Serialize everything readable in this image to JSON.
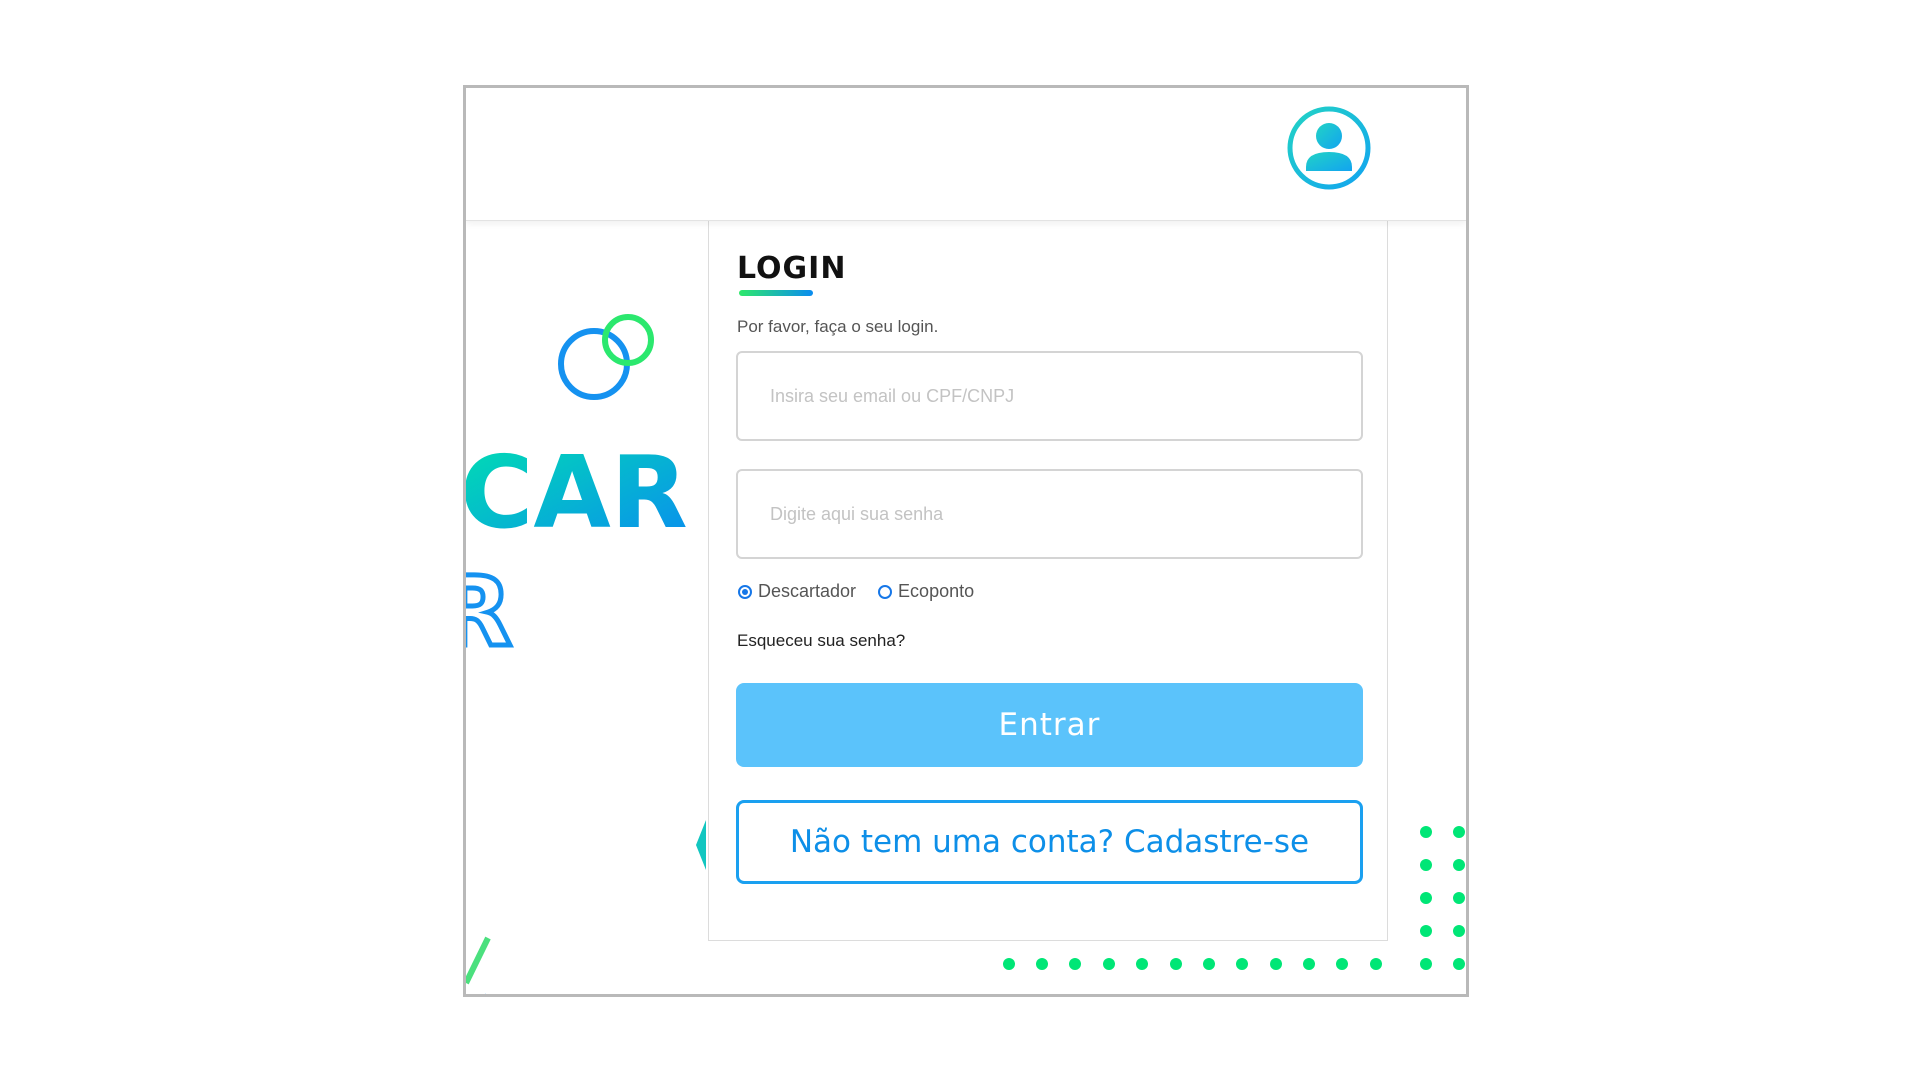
{
  "header": {
    "avatar_icon": "user-avatar-icon"
  },
  "background": {
    "brand_fragment_1": "CAR",
    "brand_fragment_2": "R"
  },
  "login": {
    "title": "LOGIN",
    "subtitle": "Por favor, faça o seu login.",
    "email_placeholder": "Insira seu email ou CPF/CNPJ",
    "password_placeholder": "Digite aqui sua senha",
    "radio_options": [
      {
        "label": "Descartador",
        "checked": true
      },
      {
        "label": "Ecoponto",
        "checked": false
      }
    ],
    "forgot_label": "Esqueceu sua senha?",
    "enter_label": "Entrar",
    "register_label": "Não tem uma conta? Cadastre-se"
  },
  "colors": {
    "primary": "#5bc3fb",
    "accent_blue": "#1aa0f0",
    "accent_green": "#00e676"
  }
}
